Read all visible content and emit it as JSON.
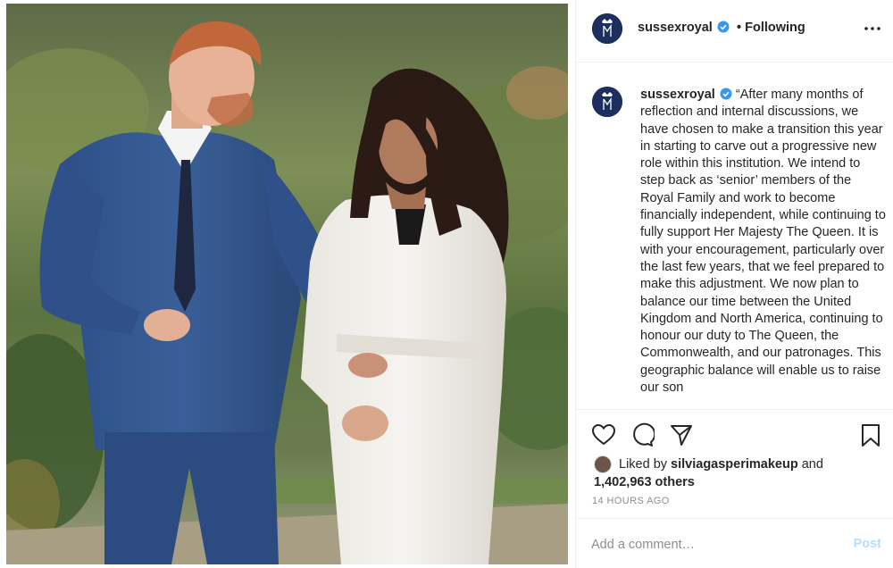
{
  "account": {
    "username": "sussexroyal",
    "follow_status": "• Following",
    "avatar_icon": "royal-monogram-icon",
    "brand_color": "#1d2f5e"
  },
  "header": {
    "more_icon": "more-options-icon"
  },
  "caption": {
    "username": "sussexroyal",
    "text": "“After many months of reflection and internal discussions, we have chosen to make a transition this year in starting to carve out a progressive new role within this institution. We intend to step back as ‘senior’ members of the Royal Family and work to become financially independent, while continuing to fully support Her Majesty The Queen. It is with your encouragement, particularly over the last few years, that we feel prepared to make this adjustment. We now plan to balance our time between the United Kingdom and North America, continuing to honour our duty to The Queen, the Commonwealth, and our patronages. This geographic balance will enable us to raise our son"
  },
  "actions": {
    "like_icon": "heart-icon",
    "comment_icon": "comment-icon",
    "share_icon": "paper-plane-icon",
    "save_icon": "bookmark-icon"
  },
  "likes": {
    "prefix": "Liked by ",
    "liker": "silviagasperimakeup",
    "and": " and",
    "count": "1,402,963 others"
  },
  "timestamp": "14 HOURS AGO",
  "comment_box": {
    "placeholder": "Add a comment…",
    "post_label": "Post",
    "post_color": "#b2dffc"
  },
  "colors": {
    "verified": "#3897f0",
    "border": "#efefef",
    "muted": "#8e8e8e"
  }
}
